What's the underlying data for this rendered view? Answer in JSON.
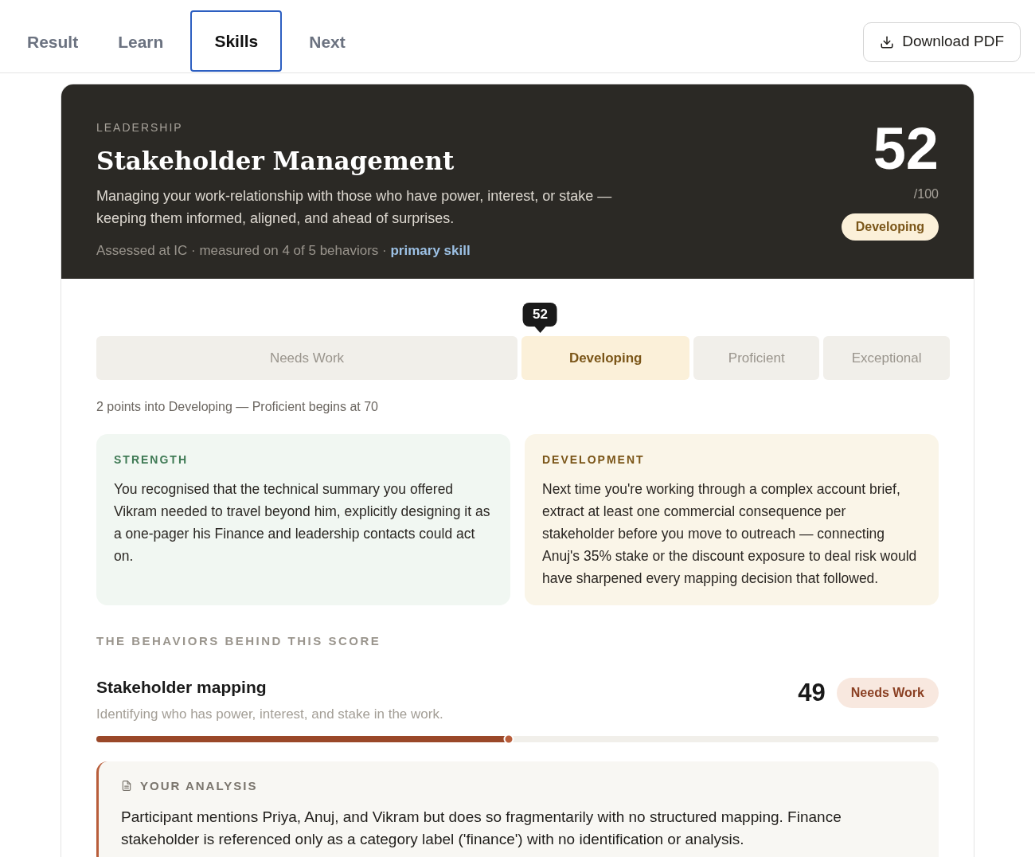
{
  "tabs": [
    {
      "label": "Result",
      "selected": false
    },
    {
      "label": "Learn",
      "selected": false
    },
    {
      "label": "Skills",
      "selected": true
    },
    {
      "label": "Next",
      "selected": false
    }
  ],
  "download_button": {
    "label": "Download PDF"
  },
  "skill": {
    "category": "LEADERSHIP",
    "title": "Stakeholder Management",
    "description": "Managing your work-relationship with those who have power, interest, or stake — keeping them informed, aligned, and ahead of surprises.",
    "meta": "Assessed at IC · measured on 4 of 5 behaviors · ",
    "primary_link": "primary skill",
    "score": "52",
    "out_of": "/100",
    "badge": "Developing"
  },
  "scale": {
    "marker": {
      "label": "52",
      "level": 0.52
    },
    "bands": [
      {
        "label": "Needs Work",
        "selected": false
      },
      {
        "label": "Developing",
        "selected": true
      },
      {
        "label": "Proficient",
        "selected": false
      },
      {
        "label": "Exceptional",
        "selected": false
      }
    ],
    "note": "2 points into Developing — Proficient begins at 70"
  },
  "feedback": [
    {
      "kind": "strength",
      "heading": "STRENGTH",
      "text": "You recognised that the technical summary you offered Vikram needed to travel beyond him, explicitly designing it as a one-pager his Finance and leadership contacts could act on."
    },
    {
      "kind": "development",
      "heading": "DEVELOPMENT",
      "text": "Next time you're working through a complex account brief, extract at least one commercial consequence per stakeholder before you move to outreach — connecting Anuj's 35% stake or the discount exposure to deal risk would have sharpened every mapping decision that followed."
    }
  ],
  "behaviors": {
    "heading": "THE BEHAVIORS BEHIND THIS SCORE",
    "items": [
      {
        "name": "Stakeholder mapping",
        "description": "Identifying who has power, interest, and stake in the work.",
        "score": "49",
        "badge": "Needs Work",
        "level": 0.49,
        "analysis": {
          "heading": "YOUR ANALYSIS",
          "text": "Participant mentions Priya, Anuj, and Vikram but does so fragmentarily with no structured mapping. Finance stakeholder is referenced only as a category label ('finance') with no identification or analysis."
        }
      }
    ]
  }
}
